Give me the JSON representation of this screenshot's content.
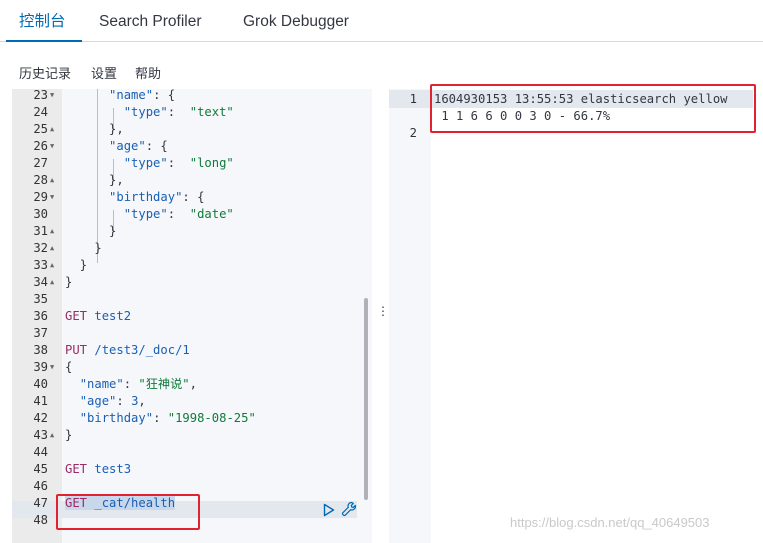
{
  "tabs": [
    "控制台",
    "Search Profiler",
    "Grok Debugger"
  ],
  "toolbar": {
    "history": "历史记录",
    "settings": "设置",
    "help": "帮助"
  },
  "editor_lines": [
    {
      "n": "23",
      "fold": "open"
    },
    {
      "n": "24",
      "fold": ""
    },
    {
      "n": "25",
      "fold": "close"
    },
    {
      "n": "26",
      "fold": "open"
    },
    {
      "n": "27",
      "fold": ""
    },
    {
      "n": "28",
      "fold": "close"
    },
    {
      "n": "29",
      "fold": "open"
    },
    {
      "n": "30",
      "fold": ""
    },
    {
      "n": "31",
      "fold": "close"
    },
    {
      "n": "32",
      "fold": "close"
    },
    {
      "n": "33",
      "fold": "close"
    },
    {
      "n": "34",
      "fold": "close"
    },
    {
      "n": "35",
      "fold": ""
    },
    {
      "n": "36",
      "fold": ""
    },
    {
      "n": "37",
      "fold": ""
    },
    {
      "n": "38",
      "fold": ""
    },
    {
      "n": "39",
      "fold": "open"
    },
    {
      "n": "40",
      "fold": ""
    },
    {
      "n": "41",
      "fold": ""
    },
    {
      "n": "42",
      "fold": ""
    },
    {
      "n": "43",
      "fold": "close"
    },
    {
      "n": "44",
      "fold": ""
    },
    {
      "n": "45",
      "fold": ""
    },
    {
      "n": "46",
      "fold": ""
    },
    {
      "n": "47",
      "fold": ""
    },
    {
      "n": "48",
      "fold": ""
    }
  ],
  "code": {
    "l23_key": "\"name\"",
    "l23_rest": ": {",
    "l24_key": "\"type\"",
    "l24_val": "\"text\"",
    "l25": "},",
    "l26_key": "\"age\"",
    "l26_rest": ": {",
    "l27_key": "\"type\"",
    "l27_val": "\"long\"",
    "l28": "},",
    "l29_key": "\"birthday\"",
    "l29_rest": ": {",
    "l30_key": "\"type\"",
    "l30_val": "\"date\"",
    "l31": "}",
    "l32": "}",
    "l33": "}",
    "l34": "}",
    "l36_method": "GET",
    "l36_path": "test2",
    "l38_method": "PUT",
    "l38_path": "/test3/_doc/1",
    "l39": "{",
    "l40_key": "\"name\"",
    "l40_val": "\"狂神说\"",
    "l41_key": "\"age\"",
    "l41_val": "3",
    "l42_key": "\"birthday\"",
    "l42_val": "\"1998-08-25\"",
    "l43": "}",
    "l45_method": "GET",
    "l45_path": "test3",
    "l47_method": "GET",
    "l47_path": "_cat/health"
  },
  "output": {
    "line_numbers": [
      "1",
      "2"
    ],
    "line1": "1604930153 13:55:53 elasticsearch yellow",
    "line1_cont": " 1 1 6 6 0 0 3 0 - 66.7%"
  },
  "watermark": "https://blog.csdn.net/qq_40649503"
}
